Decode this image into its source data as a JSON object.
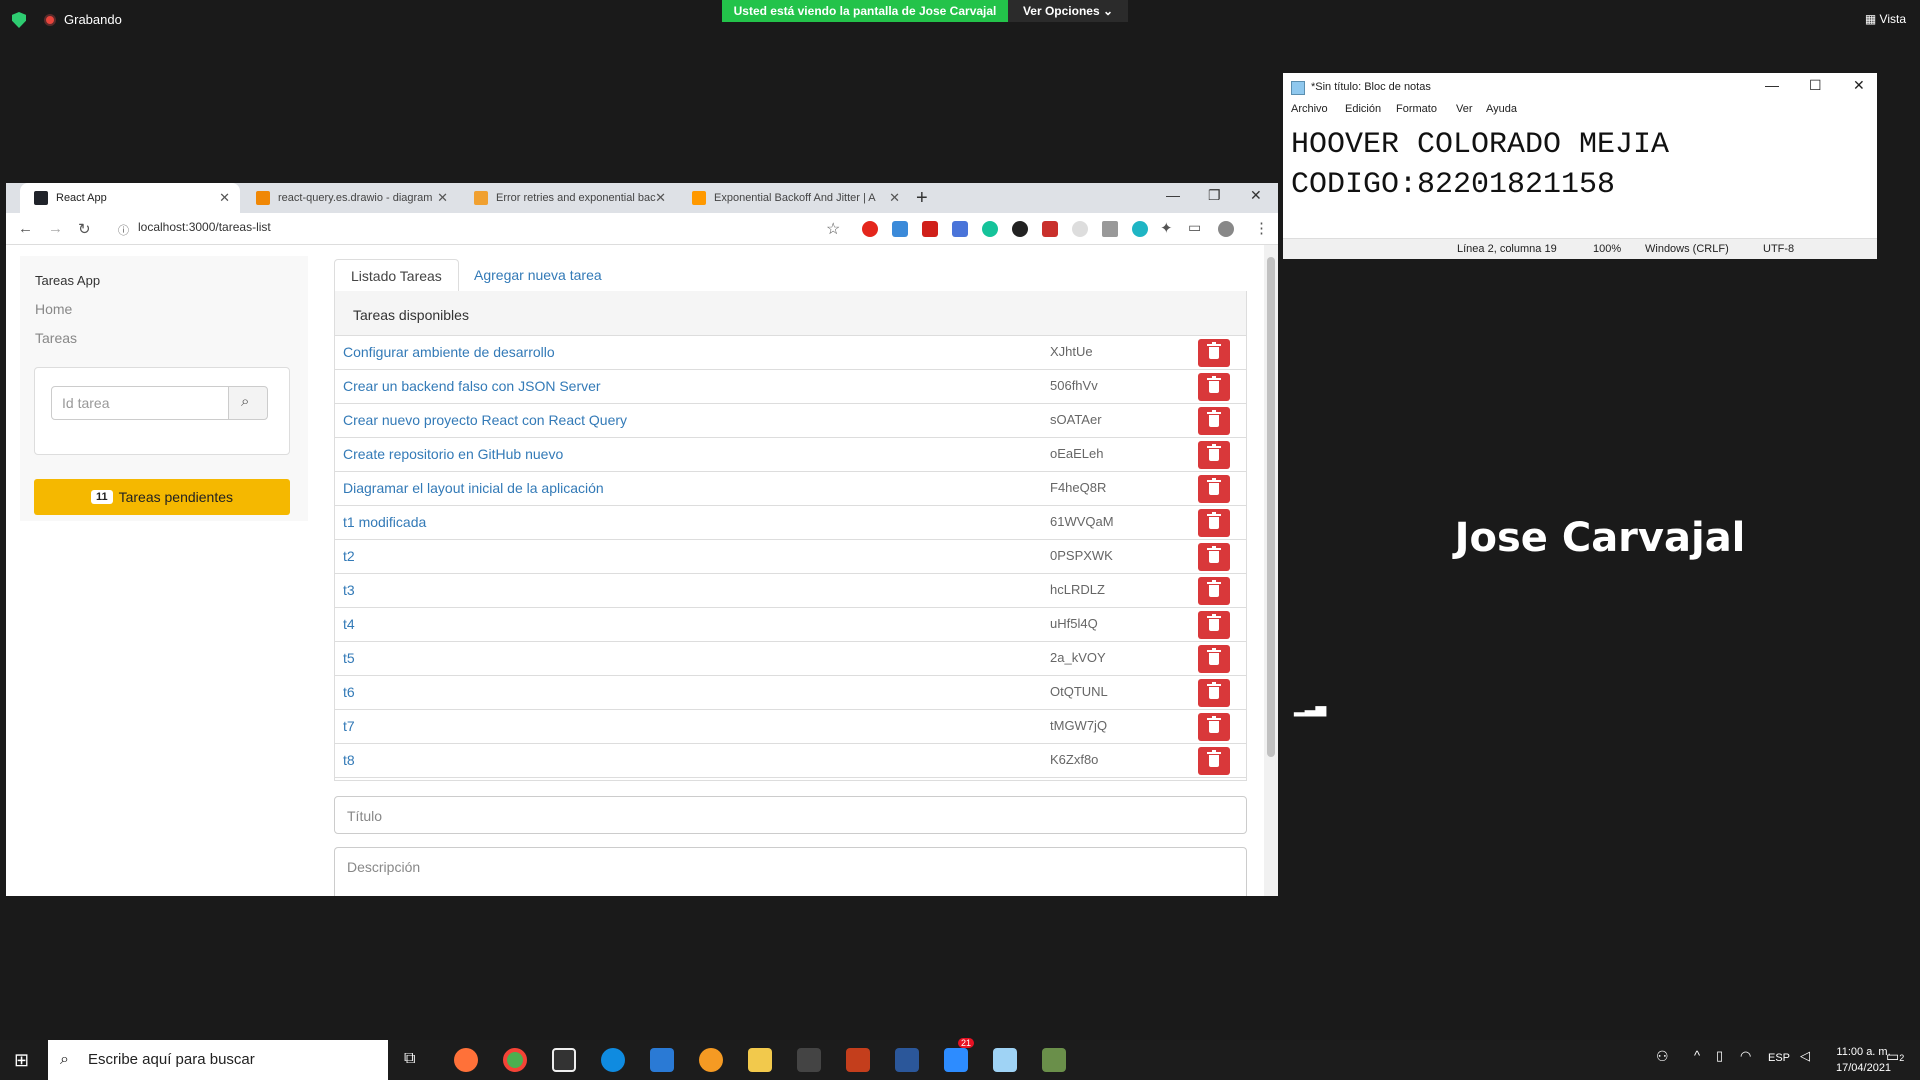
{
  "zoom": {
    "recording_label": "Grabando",
    "share_banner": "Usted está viendo la pantalla de Jose Carvajal",
    "options_label": "Ver Opciones ⌄",
    "view_label": "Vista",
    "participant_name": "Jose Carvajal"
  },
  "browser": {
    "tabs": [
      {
        "label": "React App",
        "favicon_color": "#20232a"
      },
      {
        "label": "react-query.es.drawio - diagram",
        "favicon_color": "#f08705"
      },
      {
        "label": "Error retries and exponential bac",
        "favicon_color": "#f0a030"
      },
      {
        "label": "Exponential Backoff And Jitter | A",
        "favicon_color": "#ff9900"
      }
    ],
    "url": "localhost:3000/tareas-list"
  },
  "app": {
    "brand": "Tareas App",
    "nav": [
      "Home",
      "Tareas"
    ],
    "search_placeholder": "Id tarea",
    "pending_count": "11",
    "pending_label": "Tareas pendientes",
    "tabs": [
      "Listado Tareas",
      "Agregar nueva tarea"
    ],
    "panel_title": "Tareas disponibles",
    "tasks": [
      {
        "title": "Configurar ambiente de desarrollo",
        "id": "XJhtUe"
      },
      {
        "title": "Crear un backend falso con JSON Server",
        "id": "506fhVv"
      },
      {
        "title": "Crear nuevo proyecto React con React Query",
        "id": "sOATAer"
      },
      {
        "title": "Create repositorio en GitHub nuevo",
        "id": "oEaELeh"
      },
      {
        "title": "Diagramar el layout inicial de la aplicación",
        "id": "F4heQ8R"
      },
      {
        "title": "t1 modificada",
        "id": "61WVQaM"
      },
      {
        "title": "t2",
        "id": "0PSPXWK"
      },
      {
        "title": "t3",
        "id": "hcLRDLZ"
      },
      {
        "title": "t4",
        "id": "uHf5l4Q"
      },
      {
        "title": "t5",
        "id": "2a_kVOY"
      },
      {
        "title": "t6",
        "id": "OtQTUNL"
      },
      {
        "title": "t7",
        "id": "tMGW7jQ"
      },
      {
        "title": "t8",
        "id": "K6Zxf8o"
      }
    ],
    "form_title_placeholder": "Título",
    "form_desc_placeholder": "Descripción"
  },
  "notepad": {
    "title": "*Sin título: Bloc de notas",
    "menu": [
      "Archivo",
      "Edición",
      "Formato",
      "Ver",
      "Ayuda"
    ],
    "content": "HOOVER COLORADO MEJIA\nCODIGO:82201821158",
    "status_position": "Línea 2, columna 19",
    "status_zoom": "100%",
    "status_eol": "Windows (CRLF)",
    "status_encoding": "UTF-8"
  },
  "taskbar": {
    "search_placeholder": "Escribe aquí para buscar",
    "lang": "ESP",
    "time": "11:00 a. m.",
    "date": "17/04/2021",
    "notifications": "2",
    "badge_count": "21"
  }
}
